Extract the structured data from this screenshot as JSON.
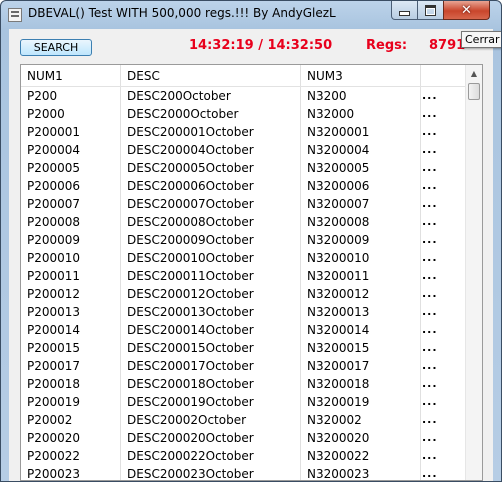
{
  "window": {
    "title": "DBEVAL() Test WITH 500,000 regs.!!!  By AndyGlezL",
    "close_tooltip": "Cerrar",
    "close_glyph": "✕"
  },
  "toolbar": {
    "search_label": "SEARCH",
    "time_range": "14:32:19  /  14:32:50",
    "regs_label": "Regs:",
    "regs_value": "8791"
  },
  "grid": {
    "headers": [
      "NUM1",
      "DESC",
      "NUM3",
      ""
    ],
    "rows": [
      [
        "P200",
        "DESC200October",
        "N3200",
        "..."
      ],
      [
        "P2000",
        "DESC2000October",
        "N32000",
        "..."
      ],
      [
        "P200001",
        "DESC200001October",
        "N3200001",
        "..."
      ],
      [
        "P200004",
        "DESC200004October",
        "N3200004",
        "..."
      ],
      [
        "P200005",
        "DESC200005October",
        "N3200005",
        "..."
      ],
      [
        "P200006",
        "DESC200006October",
        "N3200006",
        "..."
      ],
      [
        "P200007",
        "DESC200007October",
        "N3200007",
        "..."
      ],
      [
        "P200008",
        "DESC200008October",
        "N3200008",
        "..."
      ],
      [
        "P200009",
        "DESC200009October",
        "N3200009",
        "..."
      ],
      [
        "P200010",
        "DESC200010October",
        "N3200010",
        "..."
      ],
      [
        "P200011",
        "DESC200011October",
        "N3200011",
        "..."
      ],
      [
        "P200012",
        "DESC200012October",
        "N3200012",
        "..."
      ],
      [
        "P200013",
        "DESC200013October",
        "N3200013",
        "..."
      ],
      [
        "P200014",
        "DESC200014October",
        "N3200014",
        "..."
      ],
      [
        "P200015",
        "DESC200015October",
        "N3200015",
        "..."
      ],
      [
        "P200017",
        "DESC200017October",
        "N3200017",
        "..."
      ],
      [
        "P200018",
        "DESC200018October",
        "N3200018",
        "..."
      ],
      [
        "P200019",
        "DESC200019October",
        "N3200019",
        "..."
      ],
      [
        "P20002",
        "DESC20002October",
        "N320002",
        "..."
      ],
      [
        "P200020",
        "DESC200020October",
        "N3200020",
        "..."
      ],
      [
        "P200022",
        "DESC200022October",
        "N3200022",
        "..."
      ],
      [
        "P200023",
        "DESC200023October",
        "N3200023",
        "..."
      ]
    ]
  },
  "colors": {
    "time_text": "#e8001c",
    "title_bar": "#b6cde5"
  },
  "icons": [
    "app-icon",
    "minimize-icon",
    "maximize-icon",
    "close-icon",
    "scroll-up-arrow-icon"
  ]
}
